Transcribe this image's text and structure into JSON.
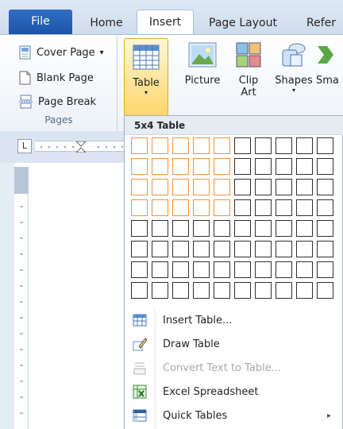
{
  "tabs": {
    "file": "File",
    "home": "Home",
    "insert": "Insert",
    "page_layout": "Page Layout",
    "references": "Refer"
  },
  "ribbon": {
    "pages_group": {
      "cover_page": "Cover Page",
      "cover_page_caret": "▾",
      "blank_page": "Blank Page",
      "page_break": "Page Break",
      "label": "Pages"
    },
    "table": {
      "label": "Table",
      "caret": "▾"
    },
    "picture": {
      "label": "Picture"
    },
    "clip_art": {
      "line1": "Clip",
      "line2": "Art"
    },
    "shapes": {
      "label": "Shapes",
      "caret": "▾"
    },
    "smartart": {
      "label": "Sma"
    }
  },
  "ruler": {
    "tab_selector": "L"
  },
  "table_dropdown": {
    "grid_label": "5x4 Table",
    "grid": {
      "columns": 10,
      "rows": 8,
      "highlight_columns": 5,
      "highlight_rows": 4
    },
    "menu_items": [
      {
        "label": "Insert Table...",
        "icon": "insert-table-icon",
        "enabled": true
      },
      {
        "label": "Draw Table",
        "icon": "draw-table-icon",
        "enabled": true
      },
      {
        "label": "Convert Text to Table...",
        "icon": "convert-text-icon",
        "enabled": false
      },
      {
        "label": "Excel Spreadsheet",
        "icon": "excel-icon",
        "enabled": true
      },
      {
        "label": "Quick Tables",
        "icon": "quick-tables-icon",
        "enabled": true,
        "submenu_arrow": "▸"
      }
    ]
  },
  "colors": {
    "file_tab": "#2563b8",
    "grid_highlight": "#ec9445",
    "table_button_active": "#ffd66b"
  }
}
